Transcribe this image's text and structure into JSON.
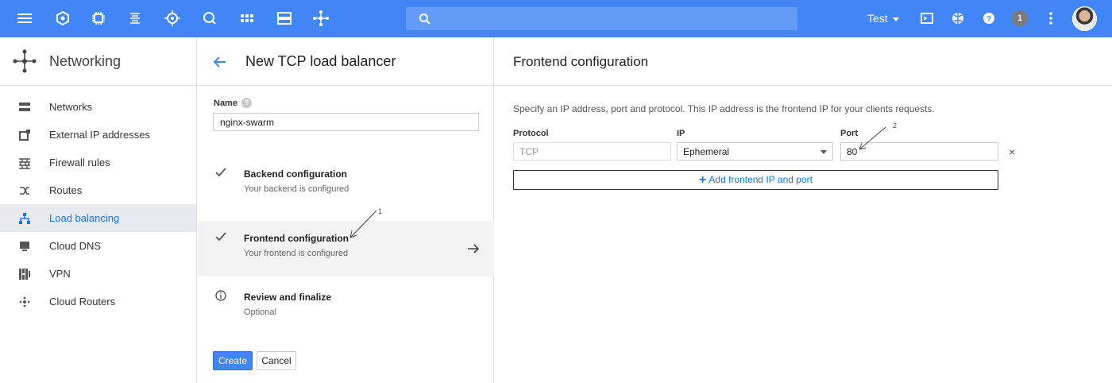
{
  "topbar": {
    "icons": [
      "menu-icon",
      "hexagon-icon",
      "chip-icon",
      "list-icon",
      "target-icon",
      "q-icon",
      "grid-icon",
      "server-icon",
      "network-icon"
    ],
    "project_label": "Test",
    "notification_count": "1"
  },
  "sidebar": {
    "title": "Networking",
    "items": [
      {
        "label": "Networks",
        "icon": "networks-icon"
      },
      {
        "label": "External IP addresses",
        "icon": "external-ip-icon"
      },
      {
        "label": "Firewall rules",
        "icon": "firewall-icon"
      },
      {
        "label": "Routes",
        "icon": "routes-icon"
      },
      {
        "label": "Load balancing",
        "icon": "load-balancing-icon",
        "active": true
      },
      {
        "label": "Cloud DNS",
        "icon": "dns-icon"
      },
      {
        "label": "VPN",
        "icon": "vpn-icon"
      },
      {
        "label": "Cloud Routers",
        "icon": "router-icon"
      }
    ]
  },
  "middle": {
    "title": "New TCP load balancer",
    "name_label": "Name",
    "name_value": "nginx-swarm",
    "steps": [
      {
        "title": "Backend configuration",
        "subtitle": "Your backend is configured",
        "icon": "check-icon"
      },
      {
        "title": "Frontend configuration",
        "subtitle": "Your frontend is configured",
        "icon": "check-icon",
        "active": true
      },
      {
        "title": "Review and finalize",
        "subtitle": "Optional",
        "icon": "info-icon"
      }
    ],
    "create_label": "Create",
    "cancel_label": "Cancel",
    "annotation_1": "1"
  },
  "right": {
    "title": "Frontend configuration",
    "description": "Specify an IP address, port and protocol. This IP address is the frontend IP for your clients requests.",
    "protocol_label": "Protocol",
    "protocol_value": "TCP",
    "ip_label": "IP",
    "ip_value": "Ephemeral",
    "port_label": "Port",
    "port_value": "80",
    "remove_symbol": "×",
    "add_label": "Add frontend IP and port",
    "annotation_2": "2"
  },
  "colors": {
    "topbar": "#4285f4",
    "accent": "#1a73e8",
    "active_bg": "#e8eaf0"
  }
}
